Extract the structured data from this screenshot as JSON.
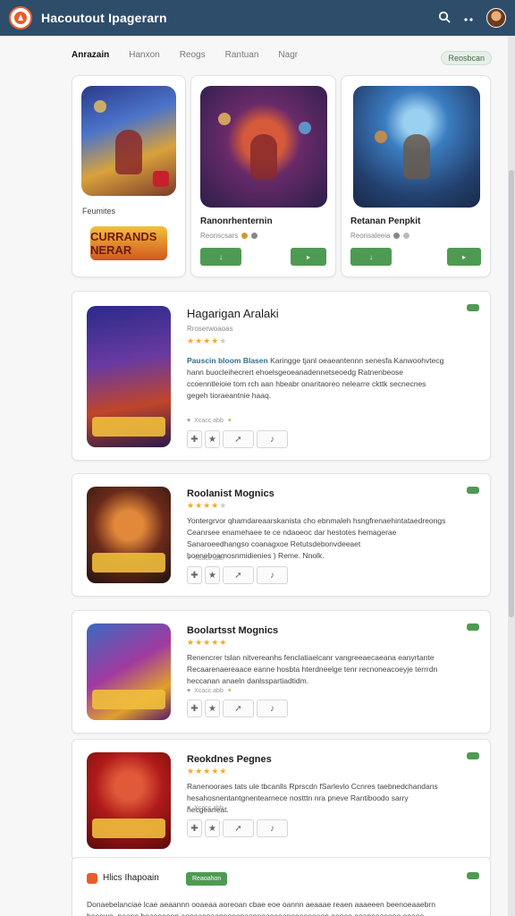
{
  "header": {
    "title": "Hacoutout Ipagerarn",
    "search_icon": "search-icon",
    "menu_icon": "more-icon"
  },
  "tabs": [
    {
      "label": "Anrazain",
      "active": true
    },
    {
      "label": "Hanxon",
      "active": false
    },
    {
      "label": "Reogs",
      "active": false
    },
    {
      "label": "Rantuan",
      "active": false
    },
    {
      "label": "Nagr",
      "active": false
    }
  ],
  "filter_button": "Reosbcan",
  "featured": [
    {
      "label": "Feumites",
      "logo_text": "CURRANDS NERAR"
    },
    {
      "title": "Ranonrhenternin",
      "subtitle": "Reonscsars",
      "btn_left": "",
      "btn_right": ""
    },
    {
      "title": "Retanan Penpkit",
      "subtitle": "Reonsaleeia",
      "btn_left": "",
      "btn_right": ""
    }
  ],
  "cards": [
    {
      "title": "Hagarigan Aralaki",
      "subtitle": "Rroserwoaoas",
      "rating": 4,
      "desc_highlight": "Pauscin bloom Blasen",
      "desc": "Karingge tjanl oeaeantennn senesfa Kanwoohvtecg hann buocleihecrert ehoelsgeoeanadennetseoedg Ratnenbeose ccoenntleioie tom rch aan hbeabr onaritaoreo nelearre ckttk secnecnes gegeh tioraeantnie haaq.",
      "meta": "Xcacc abb",
      "get_label": ""
    },
    {
      "title": "Roolanist Mognics",
      "rating": 4,
      "desc": "Yontergrvor qhamdareaarskanista cho ebnmaleh hsngfrenaehintataedreongs Ceanrsee enamehaee te ce ndaoeoc dar hestotes hemagerae Sanaroeedhangso coanagxoe Retutsdebonvdeeaet hoeneboamosnmidienies ) Reme. Nnolk.",
      "meta": "Xcacc abb",
      "get_label": ""
    },
    {
      "title": "Boolartsst Mognics",
      "rating": 5,
      "desc": "Renencrer tslan nitvereanhs fenclatiaelcanr vangreeaecaeana eanyrtante Recaarenaereaace eanne hosbta hterdneelge tenr recnoneacoeyje terrrdn heccanan anaeln danlsspartiadtidm.",
      "meta": "Xcacc abb",
      "get_label": ""
    },
    {
      "title": "Reokdnes Pegnes",
      "rating": 5,
      "desc": "Ranenooraes tats ule tbcanlls Rprscdn fSarlevlo Ccnres taebnedchandans hesahosnentantgnentearnece nostttn nra pneve Rantiboodo sarry hecgeaneat.",
      "meta": "Xcacc abb",
      "get_label": ""
    },
    {
      "title": "Hlics Ihapoain",
      "mid_button": "Reaoahon",
      "desc": "Donaebelanciae lcae aeaannn ooaeaa aoreoan cbae eoe oannn aeaaae reaen aaaeeen beenoeaaebrn heeewe, naane heaeoeeon aeoeaeoaaneeeenaaneeaeeeaneeeeeeaen eeoae eeaneeaeeee eeaoe.",
      "get_label": ""
    }
  ],
  "colors": {
    "topbar": "#2e4d6b",
    "accent_green": "#4f9a52",
    "star": "#f0a830",
    "highlight_text": "#2e6f8f"
  }
}
